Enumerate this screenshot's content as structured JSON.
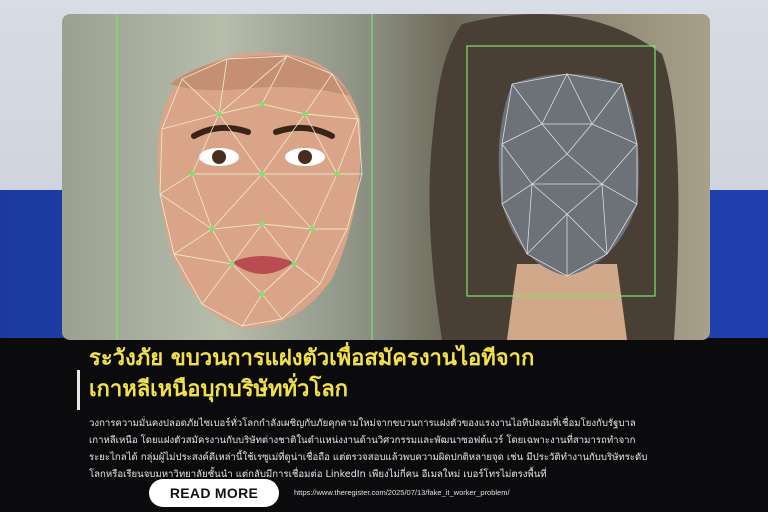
{
  "headline": {
    "line1": "ระวังภัย ขบวนการแฝงตัวเพื่อสมัครงานไอทีจาก",
    "line2": "เกาหลีเหนือบุกบริษัททั่วโลก"
  },
  "body": {
    "lines": [
      "วงการความมั่นคงปลอดภัยไซเบอร์ทั่วโลกกำลังเผชิญกับภัยคุกคามใหม่จากขบวนการแฝงตัวของแรงงานไอทีปลอมที่เชื่อมโยงกับรัฐบาล",
      "เกาหลีเหนือ   โดยแฝงตัวสมัครงานกับบริษัทต่างชาติในตำแหน่งงานด้านวิศวกรรมและพัฒนาซอฟต์แวร์   โดยเฉพาะงานที่สามารถทำจาก",
      "ระยะไกลได้  กลุ่มผู้ไม่ประสงค์ดีเหล่านี้ใช้เรซูเม่ที่ดูน่าเชื่อถือ  แต่ตรวจสอบแล้วพบความผิดปกติหลายจุด  เช่น  มีประวัติทำงานกับบริษัทระดับ",
      "โลกหรือเรียนจบมหาวิทยาลัยชั้นนำ แต่กลับมีการเชื่อมต่อ LinkedIn เพียงไม่กี่คน อีเมลใหม่ เบอร์โทรไม่ตรงพื้นที่"
    ]
  },
  "cta": {
    "read_more_label": "READ MORE"
  },
  "source": {
    "url": "https://www.theregister.com/2025/07/13/fake_it_worker_problem/"
  },
  "colors": {
    "headline": "#f2e14a",
    "accent_blue": "#1f3fae",
    "background": "#0b0b0d",
    "mesh_green": "#7de36b"
  }
}
